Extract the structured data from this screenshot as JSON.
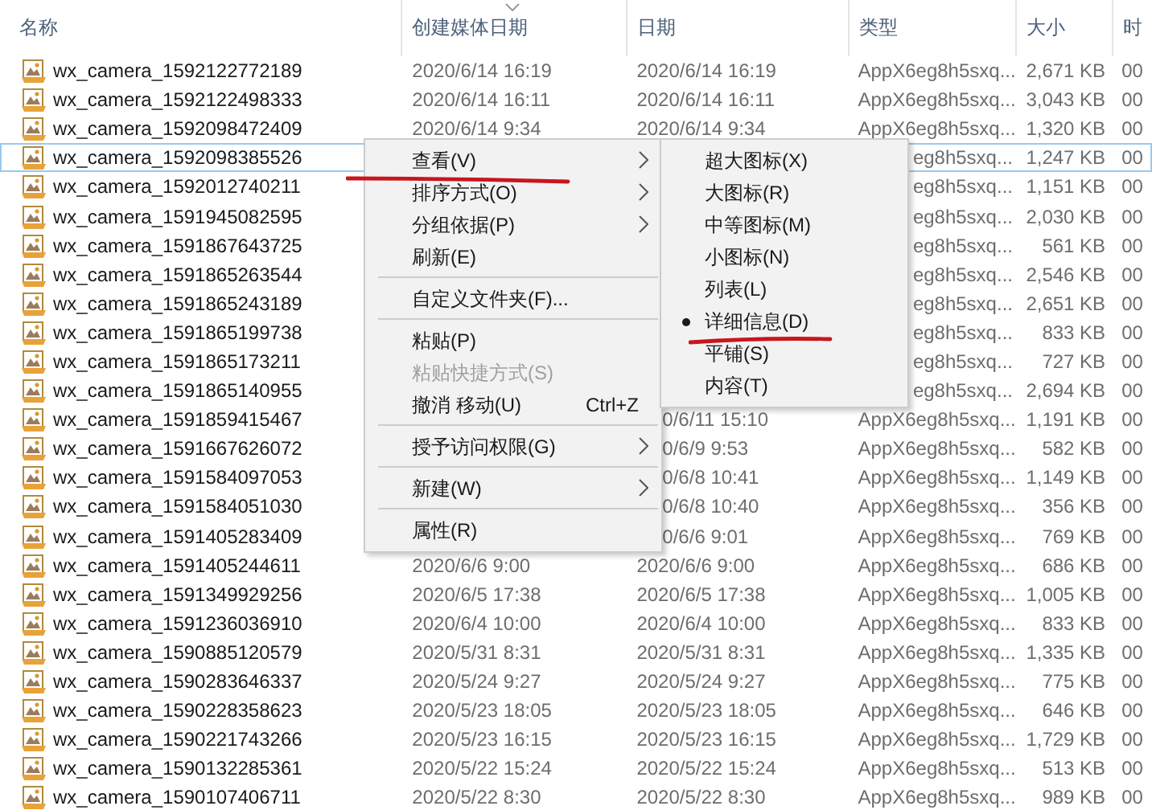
{
  "columns": [
    {
      "label": "名称",
      "sorted": false
    },
    {
      "label": "创建媒体日期",
      "sorted": true
    },
    {
      "label": "日期",
      "sorted": false
    },
    {
      "label": "类型",
      "sorted": false
    },
    {
      "label": "大小",
      "sorted": false
    },
    {
      "label": "时",
      "sorted": false
    }
  ],
  "rows": [
    {
      "name": "wx_camera_1592122772189",
      "created": "2020/6/14 16:19",
      "date": "2020/6/14 16:19",
      "type": "AppX6eg8h5sxq...",
      "size": "2,671 KB",
      "time": "00",
      "focused": false
    },
    {
      "name": "wx_camera_1592122498333",
      "created": "2020/6/14 16:11",
      "date": "2020/6/14 16:11",
      "type": "AppX6eg8h5sxq...",
      "size": "3,043 KB",
      "time": "00",
      "focused": false
    },
    {
      "name": "wx_camera_1592098472409",
      "created": "2020/6/14 9:34",
      "date": "2020/6/14 9:34",
      "type": "AppX6eg8h5sxq...",
      "size": "1,320 KB",
      "time": "00",
      "focused": false
    },
    {
      "name": "wx_camera_1592098385526",
      "type": "eg8h5sxq...",
      "size": "1,247 KB",
      "time": "00",
      "focused": true
    },
    {
      "name": "wx_camera_1592012740211",
      "type": "eg8h5sxq...",
      "size": "1,151 KB",
      "time": "00",
      "focused": false
    },
    {
      "name": "wx_camera_1591945082595",
      "type": "eg8h5sxq...",
      "size": "2,030 KB",
      "time": "00",
      "focused": false
    },
    {
      "name": "wx_camera_1591867643725",
      "type": "eg8h5sxq...",
      "size": "561 KB",
      "time": "00",
      "focused": false
    },
    {
      "name": "wx_camera_1591865263544",
      "type": "eg8h5sxq...",
      "size": "2,546 KB",
      "time": "00",
      "focused": false
    },
    {
      "name": "wx_camera_1591865243189",
      "type": "eg8h5sxq...",
      "size": "2,651 KB",
      "time": "00",
      "focused": false
    },
    {
      "name": "wx_camera_1591865199738",
      "type": "eg8h5sxq...",
      "size": "833 KB",
      "time": "00",
      "focused": false
    },
    {
      "name": "wx_camera_1591865173211",
      "type": "eg8h5sxq...",
      "size": "727 KB",
      "time": "00",
      "focused": false
    },
    {
      "name": "wx_camera_1591865140955",
      "type": "eg8h5sxq...",
      "size": "2,694 KB",
      "time": "00",
      "focused": false
    },
    {
      "name": "wx_camera_1591859415467",
      "date": "0/6/11 15:10",
      "type": "AppX6eg8h5sxq...",
      "size": "1,191 KB",
      "time": "00",
      "focused": false
    },
    {
      "name": "wx_camera_1591667626072",
      "date": "0/6/9 9:53",
      "type": "AppX6eg8h5sxq...",
      "size": "582 KB",
      "time": "00",
      "focused": false
    },
    {
      "name": "wx_camera_1591584097053",
      "date": "0/6/8 10:41",
      "type": "AppX6eg8h5sxq...",
      "size": "1,149 KB",
      "time": "00",
      "focused": false
    },
    {
      "name": "wx_camera_1591584051030",
      "date": "0/6/8 10:40",
      "type": "AppX6eg8h5sxq...",
      "size": "356 KB",
      "time": "00",
      "focused": false
    },
    {
      "name": "wx_camera_1591405283409",
      "date": "0/6/6 9:01",
      "type": "AppX6eg8h5sxq...",
      "size": "769 KB",
      "time": "00",
      "focused": false
    },
    {
      "name": "wx_camera_1591405244611",
      "created": "2020/6/6 9:00",
      "date": "2020/6/6 9:00",
      "type": "AppX6eg8h5sxq...",
      "size": "686 KB",
      "time": "00",
      "focused": false
    },
    {
      "name": "wx_camera_1591349929256",
      "created": "2020/6/5 17:38",
      "date": "2020/6/5 17:38",
      "type": "AppX6eg8h5sxq...",
      "size": "1,005 KB",
      "time": "00",
      "focused": false
    },
    {
      "name": "wx_camera_1591236036910",
      "created": "2020/6/4 10:00",
      "date": "2020/6/4 10:00",
      "type": "AppX6eg8h5sxq...",
      "size": "833 KB",
      "time": "00",
      "focused": false
    },
    {
      "name": "wx_camera_1590885120579",
      "created": "2020/5/31 8:31",
      "date": "2020/5/31 8:31",
      "type": "AppX6eg8h5sxq...",
      "size": "1,335 KB",
      "time": "00",
      "focused": false
    },
    {
      "name": "wx_camera_1590283646337",
      "created": "2020/5/24 9:27",
      "date": "2020/5/24 9:27",
      "type": "AppX6eg8h5sxq...",
      "size": "775 KB",
      "time": "00",
      "focused": false
    },
    {
      "name": "wx_camera_1590228358623",
      "created": "2020/5/23 18:05",
      "date": "2020/5/23 18:05",
      "type": "AppX6eg8h5sxq...",
      "size": "646 KB",
      "time": "00",
      "focused": false
    },
    {
      "name": "wx_camera_1590221743266",
      "created": "2020/5/23 16:15",
      "date": "2020/5/23 16:15",
      "type": "AppX6eg8h5sxq...",
      "size": "1,729 KB",
      "time": "00",
      "focused": false
    },
    {
      "name": "wx_camera_1590132285361",
      "created": "2020/5/22 15:24",
      "date": "2020/5/22 15:24",
      "type": "AppX6eg8h5sxq...",
      "size": "513 KB",
      "time": "00",
      "focused": false
    },
    {
      "name": "wx_camera_1590107406711",
      "created": "2020/5/22 8:30",
      "date": "2020/5/22 8:30",
      "type": "AppX6eg8h5sxq...",
      "size": "989 KB",
      "time": "00",
      "focused": false
    }
  ],
  "context_menu": {
    "items": [
      {
        "kind": "item",
        "label": "查看(V)",
        "submenu": true,
        "disabled": false,
        "underlined": true
      },
      {
        "kind": "item",
        "label": "排序方式(O)",
        "submenu": true,
        "disabled": false,
        "underlined": false
      },
      {
        "kind": "item",
        "label": "分组依据(P)",
        "submenu": true,
        "disabled": false,
        "underlined": false
      },
      {
        "kind": "item",
        "label": "刷新(E)",
        "submenu": false,
        "disabled": false,
        "underlined": false
      },
      {
        "kind": "separator"
      },
      {
        "kind": "item",
        "label": "自定义文件夹(F)...",
        "submenu": false,
        "disabled": false,
        "underlined": false
      },
      {
        "kind": "separator"
      },
      {
        "kind": "item",
        "label": "粘贴(P)",
        "submenu": false,
        "disabled": false,
        "underlined": false
      },
      {
        "kind": "item",
        "label": "粘贴快捷方式(S)",
        "submenu": false,
        "disabled": true,
        "underlined": false
      },
      {
        "kind": "item",
        "label": "撤消 移动(U)",
        "shortcut": "Ctrl+Z",
        "submenu": false,
        "disabled": false,
        "underlined": false
      },
      {
        "kind": "separator"
      },
      {
        "kind": "item",
        "label": "授予访问权限(G)",
        "submenu": true,
        "disabled": false,
        "underlined": false
      },
      {
        "kind": "separator"
      },
      {
        "kind": "item",
        "label": "新建(W)",
        "submenu": true,
        "disabled": false,
        "underlined": false
      },
      {
        "kind": "separator"
      },
      {
        "kind": "item",
        "label": "属性(R)",
        "submenu": false,
        "disabled": false,
        "underlined": false
      }
    ]
  },
  "view_submenu": {
    "items": [
      {
        "label": "超大图标(X)",
        "selected": false,
        "underlined": false
      },
      {
        "label": "大图标(R)",
        "selected": false,
        "underlined": false
      },
      {
        "label": "中等图标(M)",
        "selected": false,
        "underlined": false
      },
      {
        "label": "小图标(N)",
        "selected": false,
        "underlined": false
      },
      {
        "label": "列表(L)",
        "selected": false,
        "underlined": false
      },
      {
        "label": "详细信息(D)",
        "selected": true,
        "underlined": true
      },
      {
        "label": "平铺(S)",
        "selected": false,
        "underlined": false
      },
      {
        "label": "内容(T)",
        "selected": false,
        "underlined": false
      }
    ]
  }
}
